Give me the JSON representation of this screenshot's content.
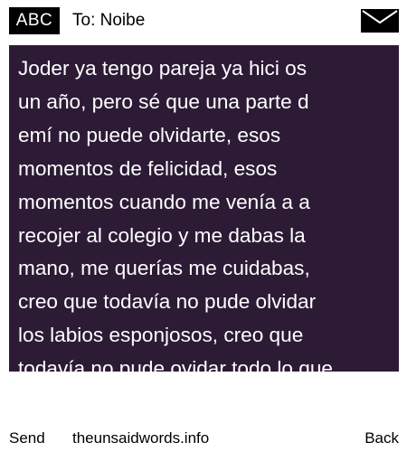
{
  "header": {
    "input_mode": "ABC",
    "to_line": "To: Noibe",
    "envelope_icon": "envelope-icon"
  },
  "message": {
    "lines": "Joder ya tengo pareja ya hici os\nun año, pero sé que una parte d\nemí no puede olvidarte, esos\nmomentos de felicidad, esos\nmomentos cuando me venía a a\nrecojer al colegio y me dabas la\nmano, me querías me cuidabas,\ncreo que todavía no pude olvidar\nlos labios esponjosos, creo que\ntodavía no pude ovidar todo lo que"
  },
  "footer": {
    "send_label": "Send",
    "site": "theunsaidwords.info",
    "back_label": "Back"
  },
  "colors": {
    "message_background": "#2d1b36",
    "message_text": "#ffffff",
    "badge_background": "#000000"
  }
}
